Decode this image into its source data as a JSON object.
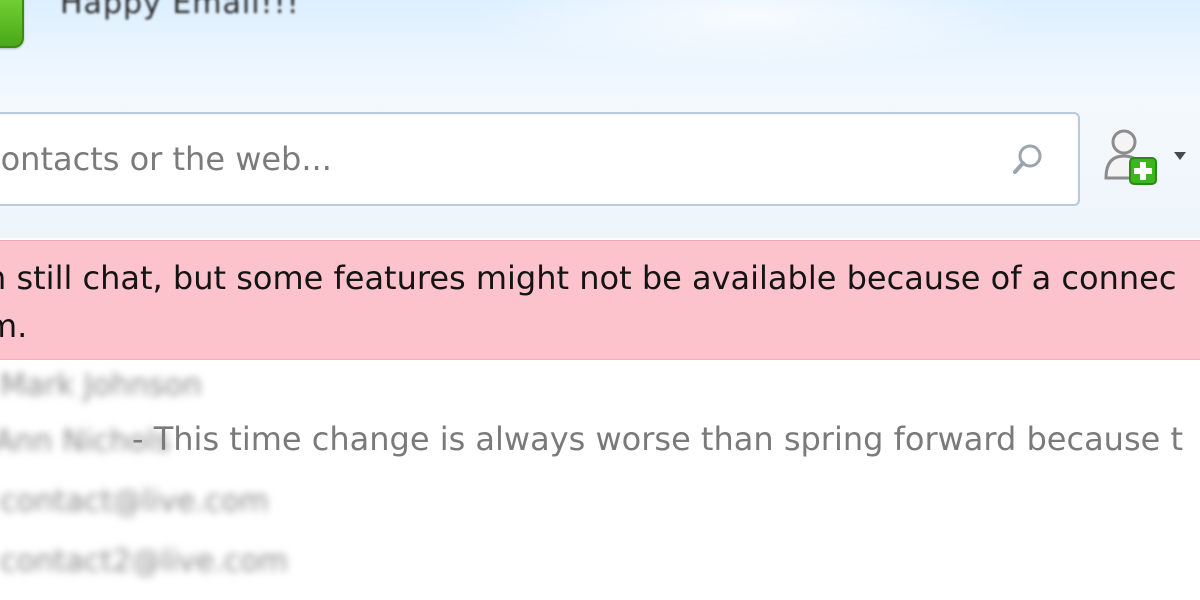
{
  "header": {
    "status_title": "Happy Email!!!"
  },
  "search": {
    "placeholder": "contacts or the web...",
    "value": ""
  },
  "warning": {
    "line1": "n still chat, but some features might not be available because of a connec",
    "line2": "m."
  },
  "contacts": {
    "items": [
      {
        "name": "Mark Johnson",
        "mood": ""
      },
      {
        "name": "Ann Nichols",
        "mood": "- This time change is always worse than spring forward because t"
      },
      {
        "name": "contact@live.com",
        "mood": ""
      },
      {
        "name": "contact2@live.com",
        "mood": ""
      }
    ]
  },
  "colors": {
    "header_top": "#dcefff",
    "banner_background": "#fcc3cd",
    "mood_text": "#7a7a7a",
    "add_plus": "#3cb521"
  },
  "icons": {
    "logo": "messenger-logo-icon",
    "search": "search-icon",
    "add_contact": "add-contact-icon",
    "dropdown": "chevron-down-icon"
  }
}
